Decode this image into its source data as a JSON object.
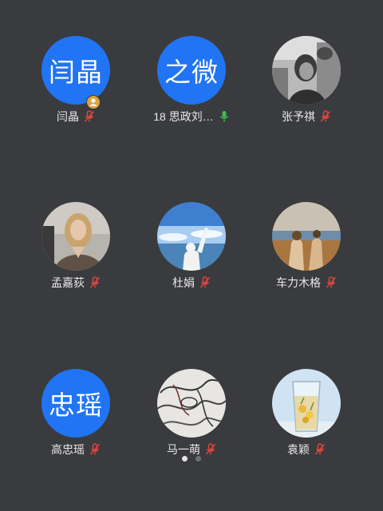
{
  "colors": {
    "background": "#3a3b3e",
    "avatar_blue": "#2174f4",
    "mic_muted": "#d9463e",
    "mic_active": "#3fbd4f",
    "host_badge": "#e2a23a"
  },
  "participants": [
    {
      "name": "闫晶",
      "avatar_text": "闫晶",
      "avatar_type": "text",
      "mic": "muted",
      "host": true
    },
    {
      "name": "18 思政刘…",
      "avatar_text": "之微",
      "avatar_type": "text",
      "mic": "active",
      "host": false
    },
    {
      "name": "张予祺",
      "avatar_type": "photo",
      "photo": "girl-with-cat-grayscale",
      "mic": "muted",
      "host": false
    },
    {
      "name": "孟嘉荻",
      "avatar_type": "photo",
      "photo": "blonde-woman-portrait",
      "mic": "muted",
      "host": false
    },
    {
      "name": "杜娟",
      "avatar_type": "photo",
      "photo": "person-raising-hand-sky",
      "mic": "muted",
      "host": false
    },
    {
      "name": "车力木格",
      "avatar_type": "photo",
      "photo": "people-on-beach",
      "mic": "muted",
      "host": false
    },
    {
      "name": "高忠瑶",
      "avatar_text": "忠瑶",
      "avatar_type": "text",
      "mic": "muted",
      "host": false
    },
    {
      "name": "马一萌",
      "avatar_type": "photo",
      "photo": "line-art-sketch",
      "mic": "muted",
      "host": false
    },
    {
      "name": "袁颖",
      "avatar_type": "photo",
      "photo": "glass-of-flower-tea",
      "mic": "muted",
      "host": false
    }
  ],
  "pagination": {
    "pages": 2,
    "current": 1
  }
}
